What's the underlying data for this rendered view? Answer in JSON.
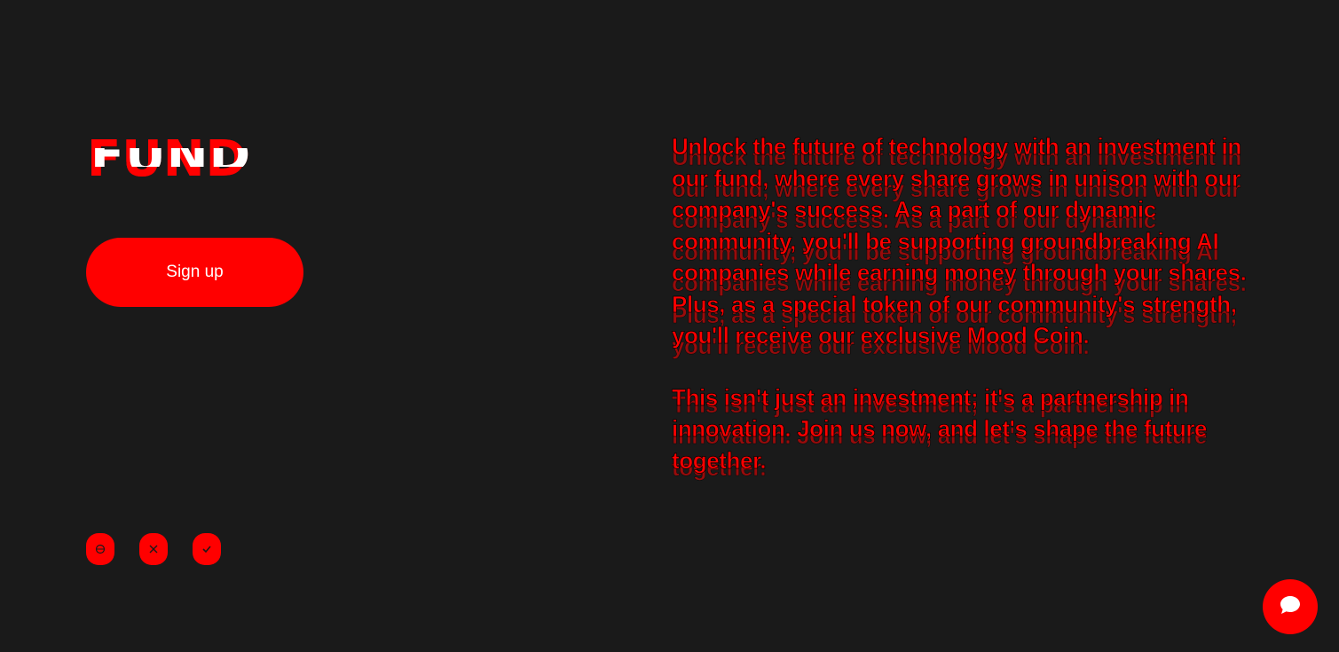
{
  "brand": {
    "logo_text": "FUND"
  },
  "hero": {
    "signup_label": "Sign up"
  },
  "social": [
    {
      "icon": "globe-icon"
    },
    {
      "icon": "x-icon"
    },
    {
      "icon": "telegram-icon"
    }
  ],
  "content": {
    "paragraph1": "Unlock the future of technology with an investment in our fund, where every share grows in unison with our company's success. As a part of our dynamic community, you'll be supporting groundbreaking AI companies while earning money through your shares. Plus, as a special token of our community's strength, you'll receive our exclusive Mood Coin.",
    "paragraph2": "This isn't just an investment; it's a partnership in innovation. Join us now, and let's shape the future together."
  },
  "chat_widget": {
    "icon": "chat-bubble-icon"
  },
  "colors": {
    "background": "#1a1a1a",
    "accent": "#ff0000",
    "text_light": "#ffffff"
  }
}
